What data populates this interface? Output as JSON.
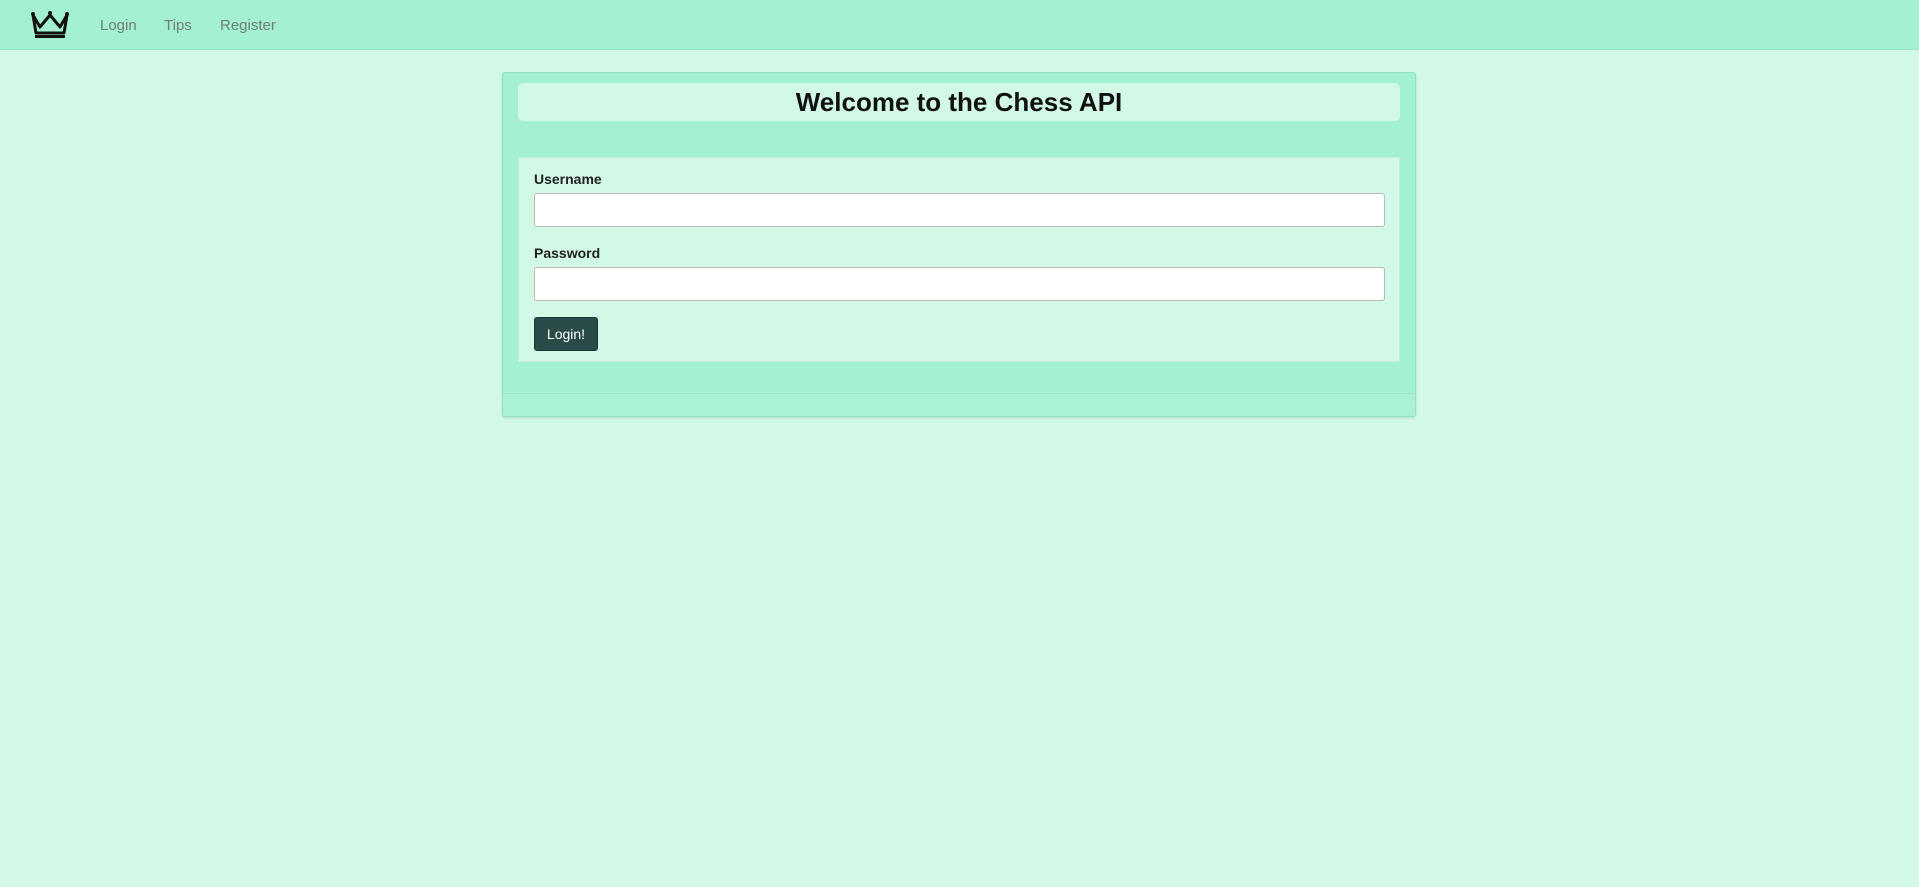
{
  "nav": {
    "logo_icon": "crown-icon",
    "links": [
      {
        "label": "Login"
      },
      {
        "label": "Tips"
      },
      {
        "label": "Register"
      }
    ]
  },
  "main": {
    "title": "Welcome to the Chess API",
    "form": {
      "username_label": "Username",
      "username_value": "",
      "password_label": "Password",
      "password_value": "",
      "submit_label": "Login!"
    }
  },
  "colors": {
    "background": "#d2f8e6",
    "navbar": "#a3f1d1",
    "button": "#2b4b48"
  }
}
